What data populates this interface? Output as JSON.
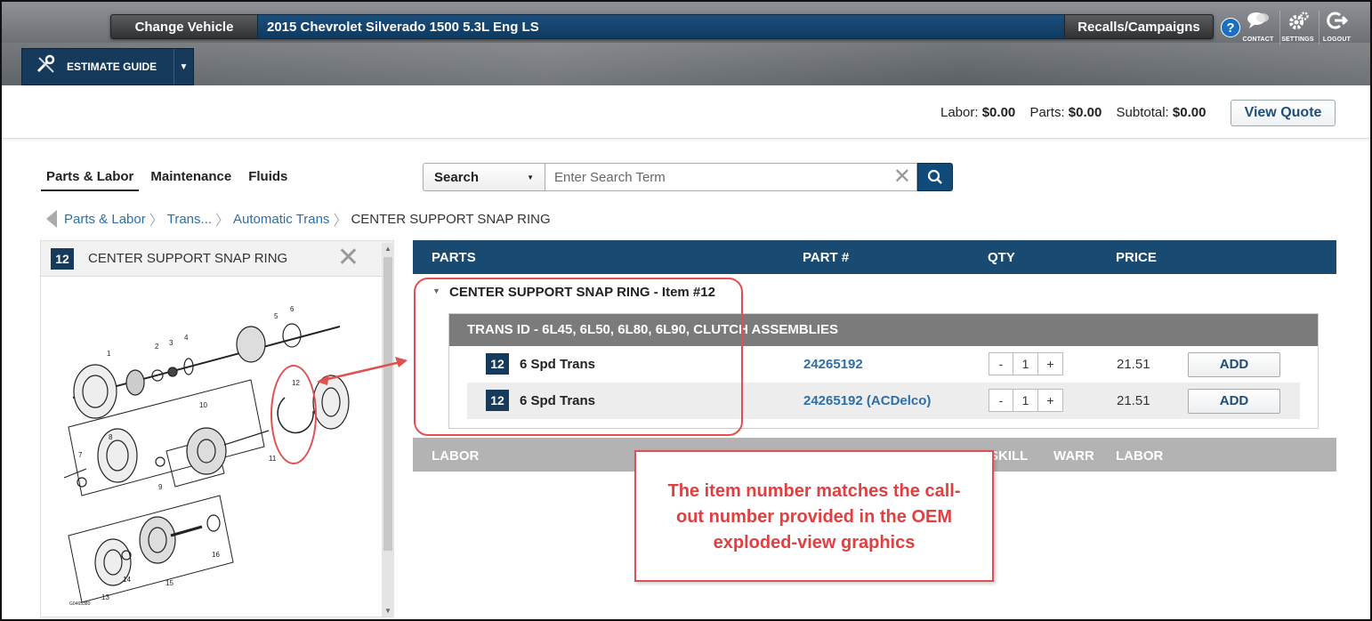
{
  "header": {
    "change_vehicle": "Change Vehicle",
    "vehicle": "2015 Chevrolet Silverado 1500 5.3L Eng LS",
    "recalls": "Recalls/Campaigns",
    "help": "?",
    "tools": [
      {
        "label": "CONTACT",
        "icon": "chat-icon"
      },
      {
        "label": "SETTINGS",
        "icon": "gear-icon"
      },
      {
        "label": "LOGOUT",
        "icon": "logout-icon"
      }
    ],
    "estimate_guide": "ESTIMATE GUIDE"
  },
  "summary": {
    "labor_label": "Labor:",
    "labor_value": "$0.00",
    "parts_label": "Parts:",
    "parts_value": "$0.00",
    "subtotal_label": "Subtotal:",
    "subtotal_value": "$0.00",
    "view_quote": "View Quote"
  },
  "tabs": [
    "Parts & Labor",
    "Maintenance",
    "Fluids"
  ],
  "search": {
    "select": "Search",
    "placeholder": "Enter Search Term"
  },
  "breadcrumb": [
    "Parts & Labor",
    "Trans...",
    "Automatic Trans",
    "CENTER SUPPORT SNAP RING"
  ],
  "left_panel": {
    "badge": "12",
    "title": "CENTER SUPPORT SNAP RING",
    "diagram_code": "G0465380",
    "callouts": [
      "1",
      "2",
      "3",
      "4",
      "5",
      "6",
      "7",
      "8",
      "9",
      "10",
      "11",
      "12",
      "13",
      "14",
      "15",
      "16"
    ]
  },
  "parts_table": {
    "headers": {
      "parts": "PARTS",
      "part_no": "PART #",
      "qty": "QTY",
      "price": "PRICE"
    },
    "group_title": "CENTER SUPPORT SNAP RING - Item #12",
    "sub_group": "TRANS ID - 6L45, 6L50, 6L80, 6L90, CLUTCH ASSEMBLIES",
    "rows": [
      {
        "badge": "12",
        "desc": "6 Spd Trans",
        "part_no": "24265192",
        "qty": "1",
        "price": "21.51",
        "add": "ADD"
      },
      {
        "badge": "12",
        "desc": "6 Spd Trans",
        "part_no": "24265192 (ACDelco)",
        "qty": "1",
        "price": "21.51",
        "add": "ADD"
      }
    ],
    "minus": "-",
    "plus": "+",
    "labor_headers": {
      "labor": "LABOR",
      "skill": "SKILL",
      "warr": "WARR",
      "labor2": "LABOR"
    }
  },
  "annotation": {
    "note": "The item number matches the call-out number provided in the OEM exploded-view graphics",
    "color": "#e05050"
  }
}
